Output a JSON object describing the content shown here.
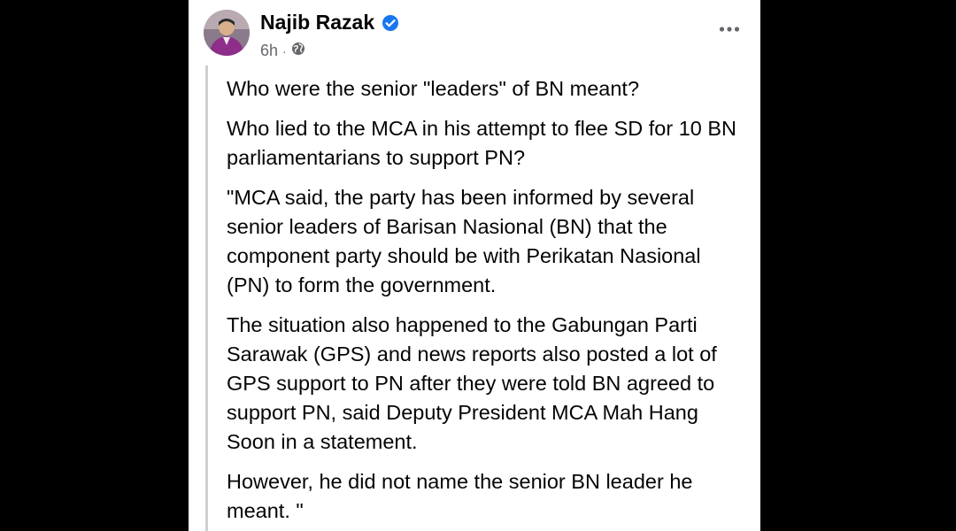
{
  "post": {
    "author_name": "Najib Razak",
    "verified_icon": "verified-badge-icon",
    "timestamp": "6h",
    "separator": "·",
    "audience_icon": "globe-icon",
    "more_icon": "more-options-icon",
    "paragraphs": [
      "Who were the senior \"leaders\" of BN meant?",
      "Who lied to the MCA in his attempt to flee SD for 10 BN parliamentarians to support PN?",
      "\"MCA said, the party has been informed by several senior leaders of Barisan Nasional (BN) that the component party should be with Perikatan Nasional (PN) to form the government.",
      "The situation also happened to the Gabungan Parti Sarawak (GPS) and news reports also posted a lot of GPS support to PN after they were told BN agreed to support PN, said Deputy President MCA Mah Hang Soon in a statement.",
      "However, he did not name the senior BN leader he meant. \""
    ]
  },
  "colors": {
    "verified": "#1877f2",
    "secondary_text": "#65676b",
    "quote_bar": "#ccd0d5",
    "background": "#000000",
    "card": "#ffffff"
  }
}
